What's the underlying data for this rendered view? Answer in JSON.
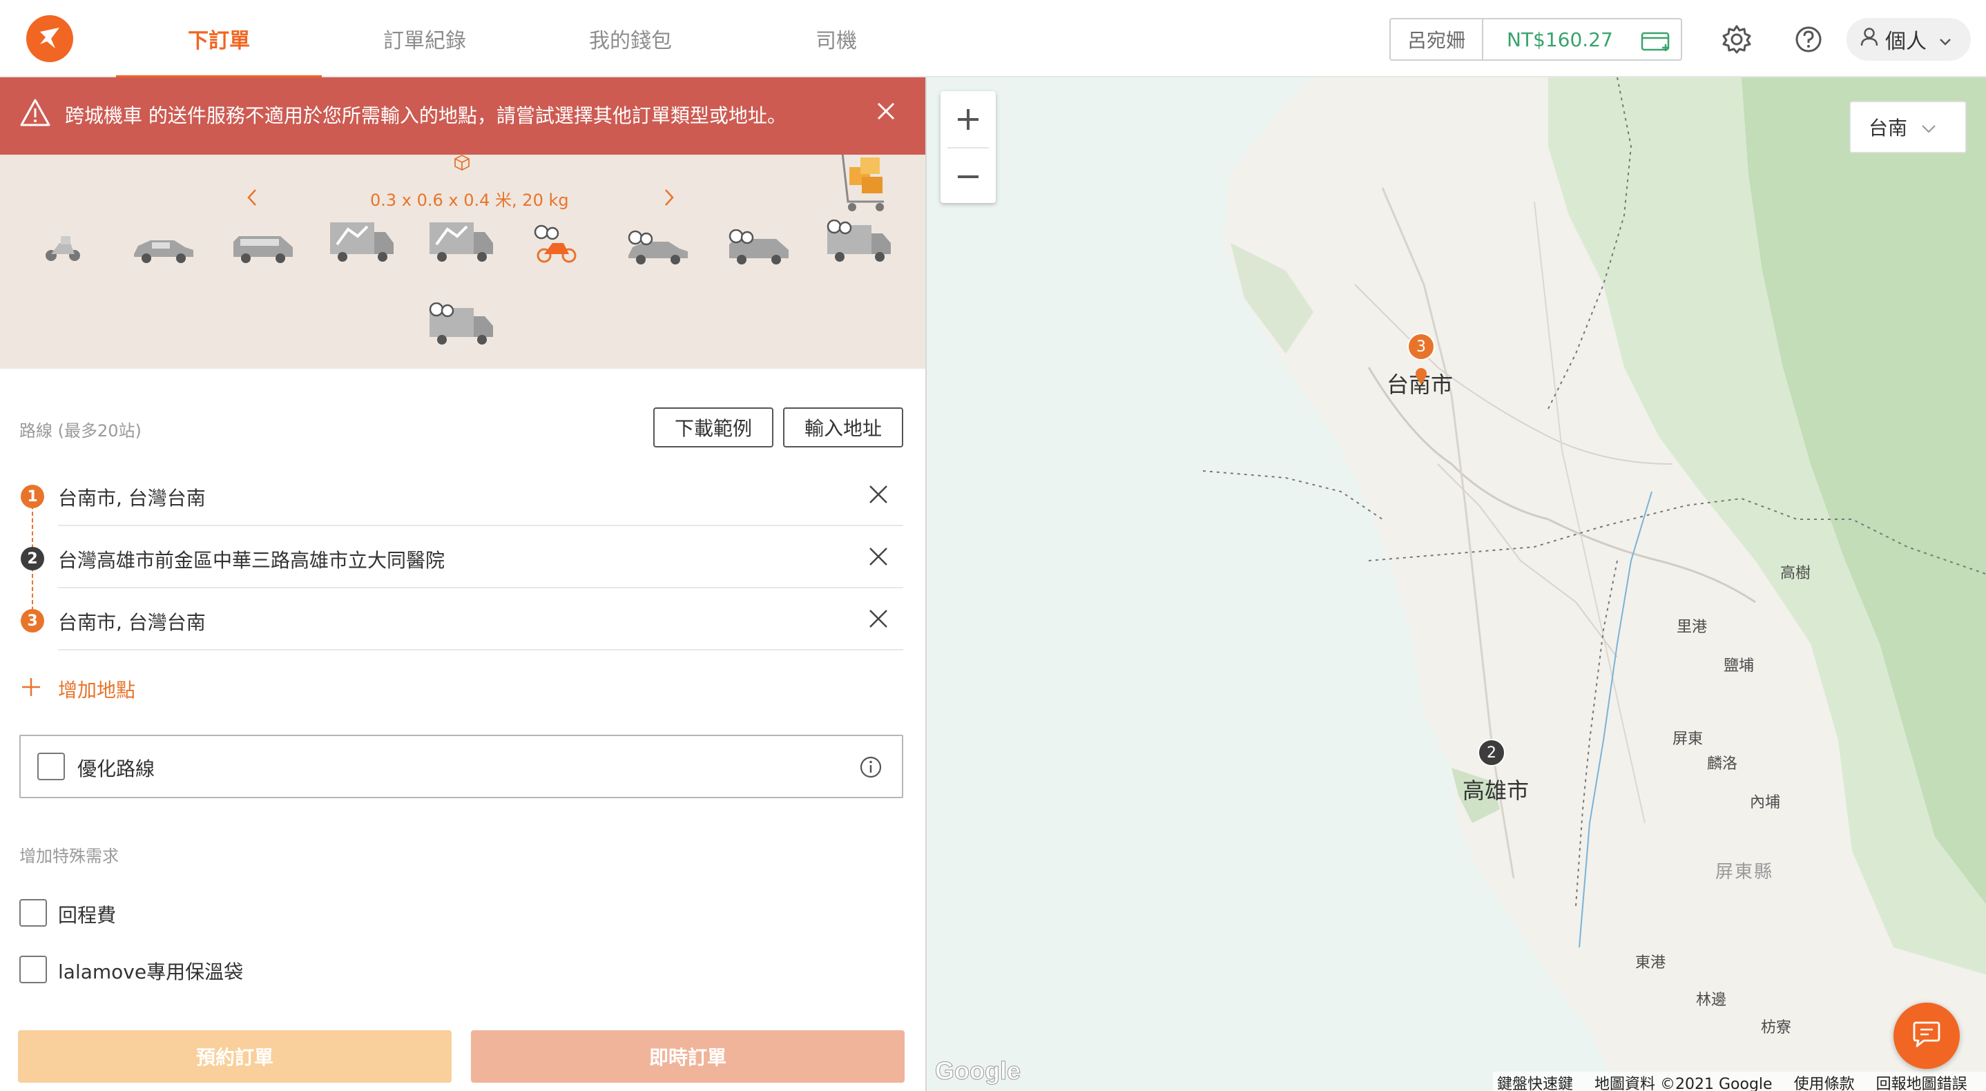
{
  "brand": {
    "accent": "#f16622",
    "alert_bg": "#cd5b52",
    "success": "#39a36c"
  },
  "nav": {
    "tabs": [
      "下訂單",
      "訂單紀錄",
      "我的錢包",
      "司機"
    ],
    "active_index": 0
  },
  "wallet": {
    "name": "呂宛姍",
    "balance": "NT$160.27",
    "icon": "wallet-add-icon"
  },
  "header_icons": [
    "gear-icon",
    "help-icon"
  ],
  "profile": {
    "label": "個人",
    "icon": "user-icon"
  },
  "alert": {
    "message": "跨城機車 的送件服務不適用於您所需輸入的地點，請嘗試選擇其他訂單類型或地址。",
    "icon": "warning-icon"
  },
  "vehicle": {
    "dimensions": "0.3 x 0.6 x 0.4 米, 20 kg",
    "items": [
      "motorcycle",
      "sedan",
      "van",
      "truck-small",
      "truck-medium",
      "intercity-motorcycle",
      "intercity-sedan",
      "intercity-van",
      "intercity-truck",
      "intercity-truck-large"
    ],
    "selected_index": 5
  },
  "route": {
    "label": "路線 (最多20站)",
    "download_example": "下載範例",
    "import_address": "輸入地址",
    "stops": [
      {
        "num": "1",
        "address": "台南市, 台灣台南",
        "color": "#e8742b"
      },
      {
        "num": "2",
        "address": "台灣高雄市前金區中華三路高雄市立大同醫院",
        "color": "#3d3d3d"
      },
      {
        "num": "3",
        "address": "台南市, 台灣台南",
        "color": "#e8742b"
      }
    ],
    "add_stop": "增加地點",
    "optimize": "優化路線"
  },
  "special": {
    "label": "增加特殊需求",
    "options": [
      "回程費",
      "lalamove專用保溫袋"
    ]
  },
  "actions": {
    "schedule": "預約訂單",
    "schedule_color": "#f9cf9b",
    "now": "即時訂單",
    "now_color": "#f0b49b"
  },
  "map": {
    "city_select": "台南",
    "zoom_in": "+",
    "zoom_out": "−",
    "cities": {
      "tainan": "台南市",
      "kaohsiung": "高雄市",
      "pingtung_county": "屏東縣"
    },
    "places": [
      "高樹",
      "里港",
      "鹽埔",
      "屏東",
      "麟洛",
      "內埔",
      "東港",
      "林邊",
      "枋寮"
    ],
    "markers": [
      {
        "num": "3",
        "color": "#e8742b"
      },
      {
        "num": "2",
        "color": "#3d3d3d"
      }
    ],
    "footer": [
      "鍵盤快速鍵",
      "地圖資料 ©2021 Google",
      "使用條款",
      "回報地圖錯誤"
    ],
    "google_logo": "Google"
  }
}
